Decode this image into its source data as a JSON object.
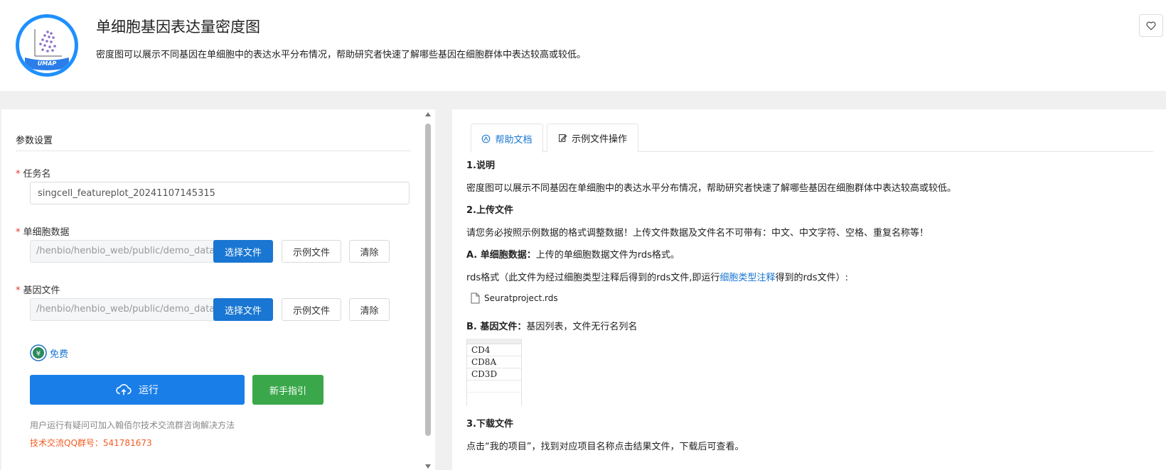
{
  "header": {
    "logo_text": "UMAP",
    "title": "单细胞基因表达量密度图",
    "description": "密度图可以展示不同基因在单细胞中的表达水平分布情况，帮助研究者快速了解哪些基因在细胞群体中表达较高或较低。",
    "favorite_icon": "heart-icon"
  },
  "form": {
    "section_title": "参数设置",
    "task": {
      "label": "任务名",
      "value": "singcell_featureplot_20241107145315"
    },
    "single_cell": {
      "label": "单细胞数据",
      "value": "/henbio/henbio_web/public/demo_data",
      "choose_label": "选择文件",
      "example_label": "示例文件",
      "clear_label": "清除"
    },
    "gene": {
      "label": "基因文件",
      "value": "/henbio/henbio_web/public/demo_data",
      "choose_label": "选择文件",
      "example_label": "示例文件",
      "clear_label": "清除"
    },
    "free_label": "免费",
    "run_label": "运行",
    "guide_label": "新手指引",
    "help_note": "用户运行有疑问可加入翰佰尔技术交流群咨询解决方法",
    "qq_note": "技术交流QQ群号：541781673"
  },
  "tabs": [
    {
      "label": "帮助文档",
      "icon": "book-icon",
      "active": true
    },
    {
      "label": "示例文件操作",
      "icon": "edit-doc-icon",
      "active": false
    }
  ],
  "doc": {
    "s1_title": "1.说明",
    "s1_text": "密度图可以展示不同基因在单细胞中的表达水平分布情况，帮助研究者快速了解哪些基因在细胞群体中表达较高或较低。",
    "s2_title": "2.上传文件",
    "s2_text": "请您务必按照示例数据的格式调整数据！上传文件数据及文件名不可带有：中文、中文字符、空格、重复名称等！",
    "a_label": "A.  单细胞数据：",
    "a_text": "上传的单细胞数据文件为rds格式。",
    "rds_prefix": "rds格式（此文件为经过细胞类型注释后得到的rds文件,即运行",
    "rds_link": "细胞类型注释",
    "rds_suffix": "得到的rds文件）:",
    "rds_file": "Seuratproject.rds",
    "b_label": "B.  基因文件：",
    "b_text": "基因列表，文件无行名列名",
    "genes": [
      "CD4",
      "CD8A",
      "CD3D"
    ],
    "s3_title": "3.下载文件",
    "s3_text": "点击“我的项目”，找到对应项目名称点击结果文件，下载后可查看。"
  }
}
